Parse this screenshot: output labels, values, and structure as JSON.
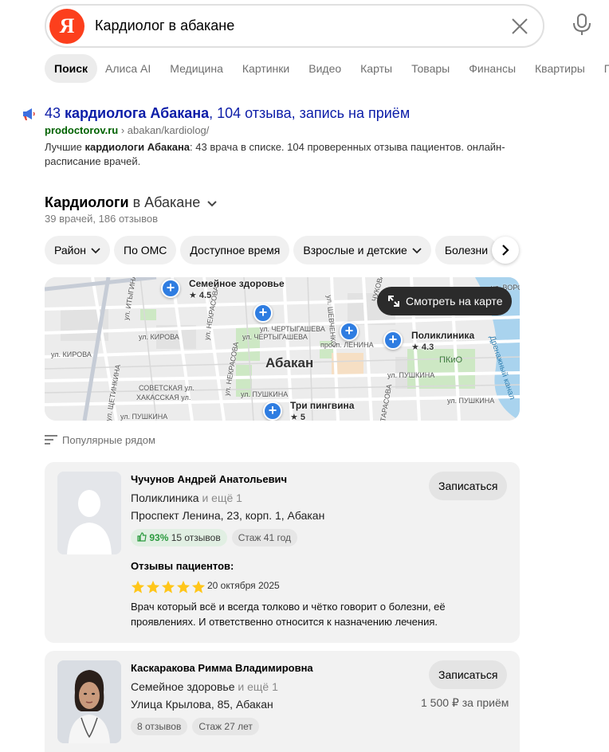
{
  "search": {
    "logo": "Я",
    "query": "Кардиолог в абакане"
  },
  "tabs": [
    "Поиск",
    "Алиса AI",
    "Медицина",
    "Картинки",
    "Видео",
    "Карты",
    "Товары",
    "Финансы",
    "Квартиры",
    "П"
  ],
  "ad": {
    "title_pre": "43 ",
    "title_bold": "кардиолога Абакана",
    "title_post": ", 104 отзыва, запись на приём",
    "domain": "prodoctorov.ru",
    "path": " › abakan/kardiolog/",
    "desc_pre": "Лучшие ",
    "desc_bold": "кардиологи Абакана",
    "desc_post": ": 43 врача в списке. 104 проверенных отзыва пациентов. онлайн-расписание врачей."
  },
  "section": {
    "title": "Кардиологи",
    "city": " в Абакане",
    "subtitle": "39 врачей, 186 отзывов"
  },
  "filters": [
    "Район",
    "По ОМС",
    "Доступное время",
    "Взрослые и детские",
    "Болезни"
  ],
  "map": {
    "button": "Смотреть на карте",
    "city": "Абакан",
    "park": "ПКиО",
    "channel": "Дренажный канал",
    "pins": [
      {
        "name": "Семейное здоровье",
        "rating": "4.5"
      },
      {
        "name": "Поликлиника",
        "rating": "4.3"
      },
      {
        "name": "Три пингвина",
        "rating": "5"
      }
    ],
    "streets": [
      "ул. ИТЫГИНА",
      "ул. КИРОВА",
      "ул. КИРОВА",
      "ул. ЧЕРТЫГАШЕВА",
      "ул. ЧЕРТЫГАШЕВА",
      "просп. ЛЕНИНА",
      "ул. ПУШКИНА",
      "ул. ПУШКИНА",
      "ул. ПУШКИНА",
      "СОВЕТСКАЯ ул.",
      "ХАКАССКАЯ ул.",
      "ул. НЕКРАСОВА",
      "ул. НЕКРАСОВА",
      "ул. ЩЕТИНКИНА",
      "ЧУКОВА",
      "ул. ШЕВЧЕНКО",
      "ул. ТАРАСОВА",
      "ул. ВОРОВСКОГО",
      "ул. ПУШКИНА"
    ]
  },
  "popular": "Популярные рядом",
  "doctors": [
    {
      "name": "Чучунов Андрей Анатольевич",
      "clinic": "Поликлиника",
      "more": " и ещё 1",
      "address": "Проспект Ленина, 23, корп. 1, Абакан",
      "percent": "93%",
      "reviews": "15 отзывов",
      "experience": "Стаж 41 год",
      "book": "Записаться",
      "reviews_header": "Отзывы пациентов:",
      "rating": 5,
      "review_date": "20 октября 2025",
      "review_text": "Врач который всё и всегда толково и чётко говорит о болезни, её проявлениях. И ответственно относится к назначению лечения."
    },
    {
      "name": "Каскаракова Римма Владимировна",
      "clinic": "Семейное здоровье",
      "more": " и ещё 1",
      "address": "Улица Крылова, 85, Абакан",
      "reviews": "8 отзывов",
      "experience": "Стаж 27 лет",
      "book": "Записаться",
      "price": "1 500 ₽ за приём"
    }
  ],
  "colors": {
    "brand": "#fc3f1d",
    "link": "#0c1da8",
    "pin": "#2f7de1",
    "positive": "#2b9a3e",
    "star": "#ffc61a"
  }
}
